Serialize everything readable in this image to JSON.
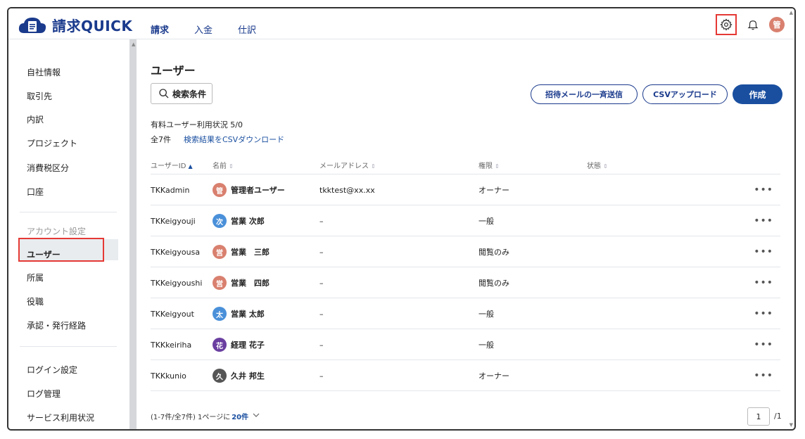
{
  "app": {
    "title": "請求QUICK"
  },
  "topnav": [
    {
      "label": "請求",
      "active": true
    },
    {
      "label": "入金",
      "active": false
    },
    {
      "label": "仕訳",
      "active": false
    }
  ],
  "header": {
    "icons": [
      "gear-icon",
      "bell-icon"
    ],
    "avatar": {
      "initial": "管",
      "color": "#d9806f"
    }
  },
  "sidebar": {
    "items": [
      {
        "label": "自社情報"
      },
      {
        "label": "取引先"
      },
      {
        "label": "内訳"
      },
      {
        "label": "プロジェクト"
      },
      {
        "label": "消費税区分"
      },
      {
        "label": "口座"
      }
    ],
    "section_label": "アカウント設定",
    "account_items": [
      {
        "label": "ユーザー",
        "active": true
      },
      {
        "label": "所属"
      },
      {
        "label": "役職"
      },
      {
        "label": "承認・発行経路"
      }
    ],
    "bottom_items": [
      {
        "label": "ログイン設定"
      },
      {
        "label": "ログ管理"
      },
      {
        "label": "サービス利用状況"
      }
    ]
  },
  "main": {
    "title": "ユーザー",
    "search_button": "検索条件",
    "invite_button": "招待メールの一斉送信",
    "csv_upload_button": "CSVアップロード",
    "create_button": "作成",
    "usage_text": "有料ユーザー利用状況 5/0",
    "count_text": "全7件",
    "csv_download_link": "検索結果をCSVダウンロード",
    "columns": [
      {
        "label": "ユーザーID",
        "sort": "▲"
      },
      {
        "label": "名前",
        "sort": "⇕"
      },
      {
        "label": "メールアドレス",
        "sort": "⇕"
      },
      {
        "label": "権限",
        "sort": "⇕"
      },
      {
        "label": "状態",
        "sort": "⇕"
      }
    ],
    "rows": [
      {
        "id": "TKKadmin",
        "initial": "管",
        "color": "#d9806f",
        "name": "管理者ユーザー",
        "email": "tkktest@xx.xx",
        "role": "オーナー",
        "status": ""
      },
      {
        "id": "TKKeigyouji",
        "initial": "次",
        "color": "#4a90d9",
        "name": "営業 次郎",
        "email": "–",
        "role": "一般",
        "status": ""
      },
      {
        "id": "TKKeigyousa",
        "initial": "営",
        "color": "#d9806f",
        "name": "営業　三郎",
        "email": "–",
        "role": "閲覧のみ",
        "status": ""
      },
      {
        "id": "TKKeigyoushi",
        "initial": "営",
        "color": "#d9806f",
        "name": "営業　四郎",
        "email": "–",
        "role": "閲覧のみ",
        "status": ""
      },
      {
        "id": "TKKeigyout",
        "initial": "太",
        "color": "#4a90d9",
        "name": "営業 太郎",
        "email": "–",
        "role": "一般",
        "status": ""
      },
      {
        "id": "TKKkeiriha",
        "initial": "花",
        "color": "#6a3fa0",
        "name": "経理 花子",
        "email": "–",
        "role": "一般",
        "status": ""
      },
      {
        "id": "TKKkunio",
        "initial": "久",
        "color": "#555555",
        "name": "久井 邦生",
        "email": "–",
        "role": "オーナー",
        "status": ""
      }
    ],
    "more_label": "•••",
    "pager": {
      "range_text": "(1-7件/全7件) 1ページに",
      "per_page": "20件",
      "current_page": "1",
      "total_pages": "/1"
    }
  }
}
